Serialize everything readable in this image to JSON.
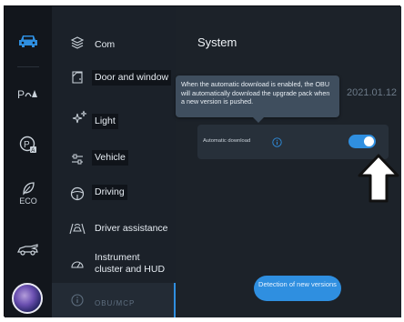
{
  "rail": {
    "items": [
      {
        "icon": "car-icon",
        "label": ""
      },
      {
        "icon": "parking-assist-icon",
        "label": ""
      },
      {
        "icon": "auto-park-icon",
        "label": ""
      },
      {
        "icon": "eco-leaf-icon",
        "label": "ECO"
      },
      {
        "icon": "car-side-icon",
        "label": ""
      }
    ],
    "avatar": "avatar"
  },
  "menu": {
    "items": [
      {
        "label": "Com",
        "icon": "com-layers-icon",
        "selected": false
      },
      {
        "label": "Door and window",
        "icon": "door-icon",
        "selected": false
      },
      {
        "label": "Light",
        "icon": "light-sparkle-icon",
        "selected": false
      },
      {
        "label": "Vehicle",
        "icon": "vehicle-sliders-icon",
        "selected": false
      },
      {
        "label": "Driving",
        "icon": "steering-wheel-icon",
        "selected": false
      },
      {
        "label": "Driver assistance",
        "icon": "driver-assist-icon",
        "selected": false
      },
      {
        "label": "Instrument cluster and HUD",
        "icon": "gauge-icon",
        "selected": false
      },
      {
        "label": "OBU/MCP",
        "icon": "info-icon",
        "selected": true
      }
    ]
  },
  "content": {
    "title": "System",
    "date": "2021.01.12",
    "tooltip": "When the automatic download is enabled, the OBU will automatically download the upgrade pack when a new version is pushed.",
    "auto_download_label": "Automatic download",
    "auto_download_on": true,
    "detect_button": "Detection of new versions"
  },
  "colors": {
    "accent": "#2f8fe0",
    "background": "#0d1117",
    "panel": "#1b2129",
    "tooltip": "#3f4e5e"
  }
}
